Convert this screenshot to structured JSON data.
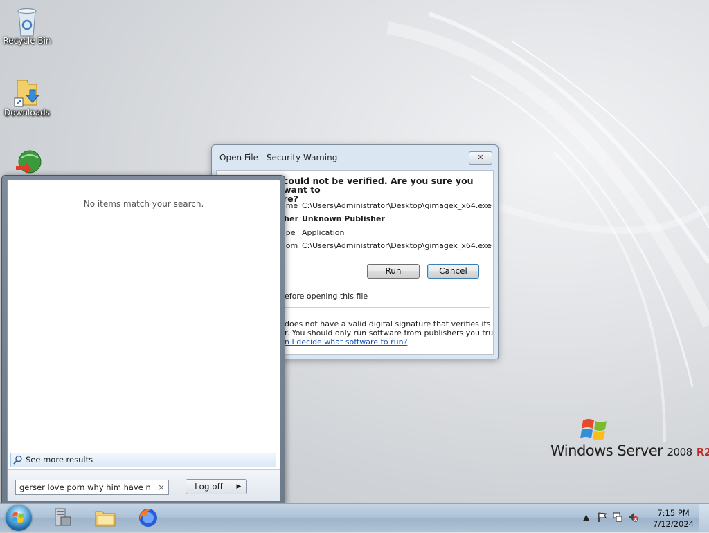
{
  "desktop": {
    "icons": [
      {
        "label": "Recycle Bin",
        "icon": "recycle-bin-icon"
      },
      {
        "label": "Downloads",
        "icon": "folder-shortcut-icon"
      },
      {
        "label": "",
        "icon": "globe-download-icon"
      }
    ],
    "branding": {
      "product": "Windows Server",
      "version": "2008",
      "edition": "R2"
    }
  },
  "dialog": {
    "title": "Open File - Security Warning",
    "close_glyph": "✕",
    "question_line1": "could not be verified.  Are you sure you want to",
    "question_line2": "re?",
    "fields": [
      {
        "key": "me:",
        "value": "C:\\Users\\Administrator\\Desktop\\gimagex_x64.exe"
      },
      {
        "key": "her:",
        "value": "Unknown Publisher"
      },
      {
        "key": "pe:",
        "value": "Application"
      },
      {
        "key": "om:",
        "value": "C:\\Users\\Administrator\\Desktop\\gimagex_x64.exe"
      }
    ],
    "run_label": "Run",
    "cancel_label": "Cancel",
    "checkbox_text": "efore opening this file",
    "warning_line1": "does not have a valid digital signature that verifies its",
    "warning_line2": "r.  You should only run software from publishers you trust.",
    "link_text": "n I decide what software to run?"
  },
  "start_menu": {
    "no_items_text": "No items match your search.",
    "see_more_label": "See more results",
    "search_value": "gerser love porn why him have n",
    "clear_glyph": "×",
    "logoff_label": "Log off",
    "logoff_arrow": "▶"
  },
  "taskbar": {
    "items": [
      {
        "name": "server-manager",
        "icon": "server-manager-icon"
      },
      {
        "name": "windows-explorer",
        "icon": "folder-icon"
      },
      {
        "name": "firefox",
        "icon": "firefox-icon"
      }
    ],
    "tray": {
      "chevron": "▲",
      "time": "7:15 PM",
      "date": "7/12/2024"
    }
  },
  "colors": {
    "taskbar": "#adc2d7",
    "dialog_frame": "#dbe6f3",
    "link": "#1b53b7",
    "brand_r2": "#c32a2a"
  }
}
